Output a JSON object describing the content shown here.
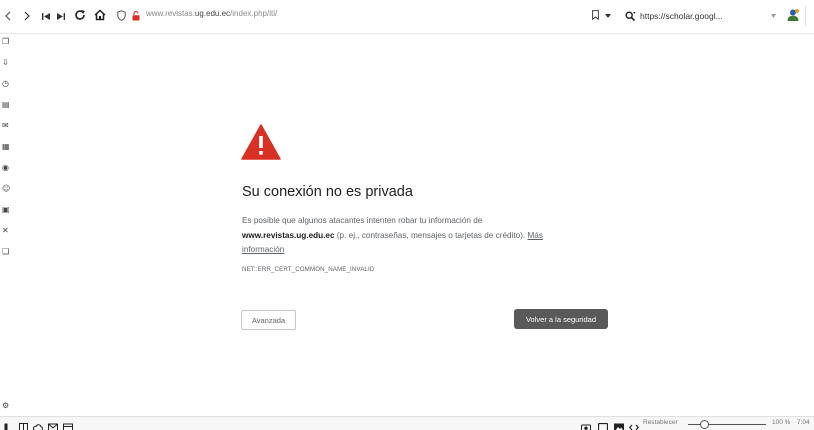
{
  "browser": {
    "url_prefix": "www.revistas.",
    "url_domain": "ug.edu.ec",
    "url_path": "/index.php/iti/",
    "search_text": "https://scholar.googl...",
    "icons": [
      "back-icon",
      "forward-icon",
      "first-page-icon",
      "last-page-icon",
      "reload-icon",
      "home-icon",
      "shield-icon",
      "lock-broken-icon",
      "bookmark-icon",
      "search-engine-icon",
      "profile-icon"
    ]
  },
  "error_page": {
    "title": "Su conexión no es privada",
    "paragraph_intro": "Es posible que algunos atacantes intenten robar tu información de",
    "paragraph_domain": "www.revistas.ug.edu.ec",
    "paragraph_tail": " (p. ej., contraseñas, mensajes o tarjetas de crédito). ",
    "more_info_link": "Más información",
    "error_code": "NET::ERR_CERT_COMMON_NAME_INVALID",
    "advanced_button": "Avanzada",
    "back_button": "Volver a la seguridad",
    "warning_color": "#d93025"
  },
  "statusbar": {
    "reset_label": "Restablecer",
    "zoom_label": "100 %",
    "time": "7:04",
    "zoom_level_percent": 100
  }
}
